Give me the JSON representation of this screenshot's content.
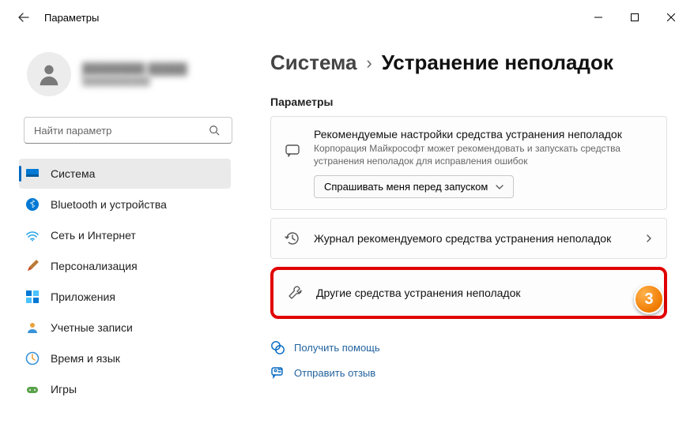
{
  "window": {
    "app_title": "Параметры"
  },
  "profile": {
    "name": "████████ █████",
    "email": "███████████"
  },
  "search": {
    "placeholder": "Найти параметр"
  },
  "sidebar": {
    "items": [
      {
        "label": "Система"
      },
      {
        "label": "Bluetooth и устройства"
      },
      {
        "label": "Сеть и Интернет"
      },
      {
        "label": "Персонализация"
      },
      {
        "label": "Приложения"
      },
      {
        "label": "Учетные записи"
      },
      {
        "label": "Время и язык"
      },
      {
        "label": "Игры"
      }
    ]
  },
  "breadcrumb": {
    "parent": "Система",
    "sep": "›",
    "current": "Устранение неполадок"
  },
  "section": {
    "label": "Параметры"
  },
  "cards": {
    "recommended": {
      "title": "Рекомендуемые настройки средства устранения неполадок",
      "desc": "Корпорация Майкрософт может рекомендовать и запускать средства устранения неполадок для исправления ошибок",
      "dropdown_label": "Спрашивать меня перед запуском"
    },
    "history": {
      "title": "Журнал рекомендуемого средства устранения неполадок"
    },
    "other": {
      "title": "Другие средства устранения неполадок"
    }
  },
  "links": {
    "help": "Получить помощь",
    "feedback": "Отправить отзыв"
  },
  "annotation": {
    "badge": "3"
  }
}
